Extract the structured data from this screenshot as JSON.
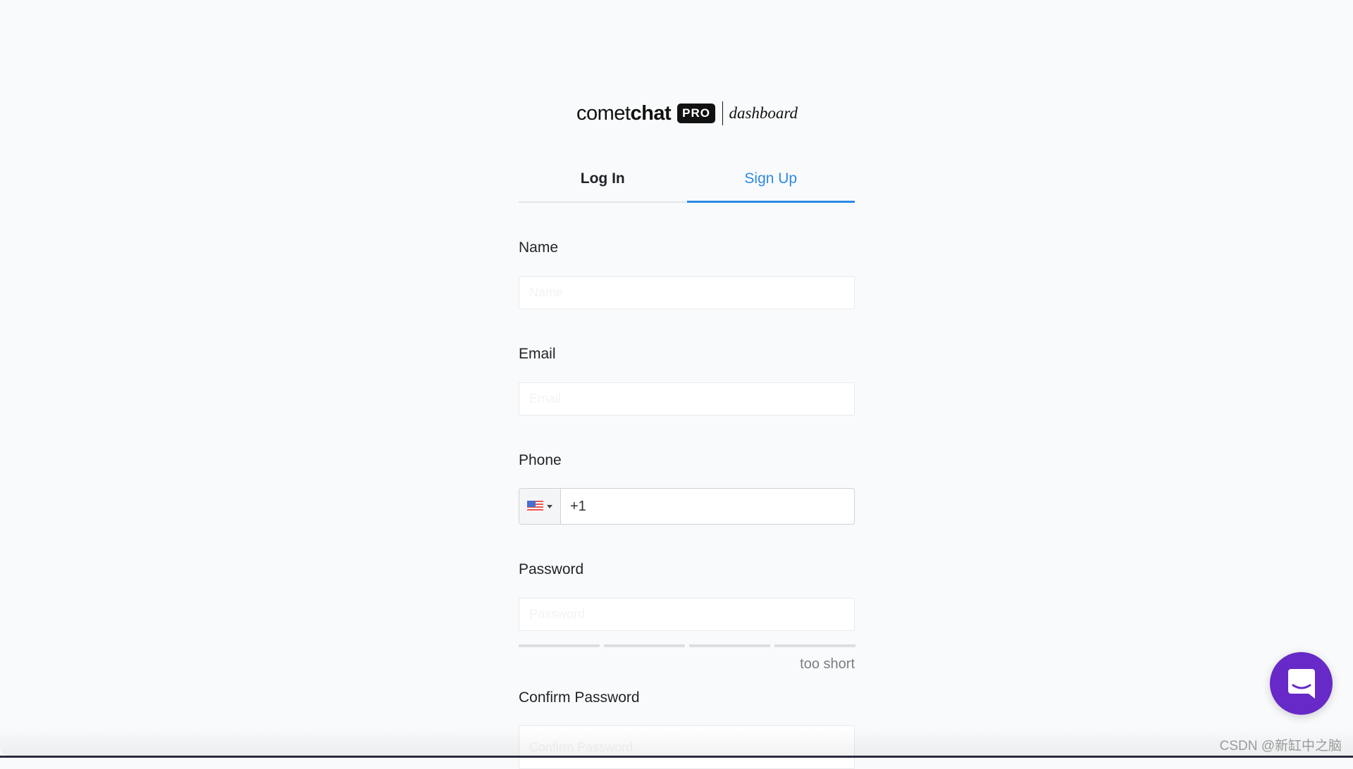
{
  "logo": {
    "brand_light": "comet",
    "brand_bold": "chat",
    "badge": "PRO",
    "product": "dashboard"
  },
  "tabs": [
    {
      "label": "Log In",
      "active": false
    },
    {
      "label": "Sign Up",
      "active": true
    }
  ],
  "form": {
    "name": {
      "label": "Name",
      "placeholder": "Name",
      "value": ""
    },
    "email": {
      "label": "Email",
      "placeholder": "Email",
      "value": ""
    },
    "phone": {
      "label": "Phone",
      "country": "US",
      "country_icon": "us-flag-icon",
      "value": "+1"
    },
    "password": {
      "label": "Password",
      "placeholder": "Password",
      "value": "",
      "strength_text": "too short",
      "strength_level": 0
    },
    "confirm_password": {
      "label": "Confirm Password",
      "placeholder": "Confirm Password",
      "value": ""
    }
  },
  "chat_widget": {
    "icon": "chat-bubble-icon",
    "color": "#6729c7"
  },
  "accent_color": "#2d8ae6",
  "watermark": "CSDN @新缸中之脑"
}
